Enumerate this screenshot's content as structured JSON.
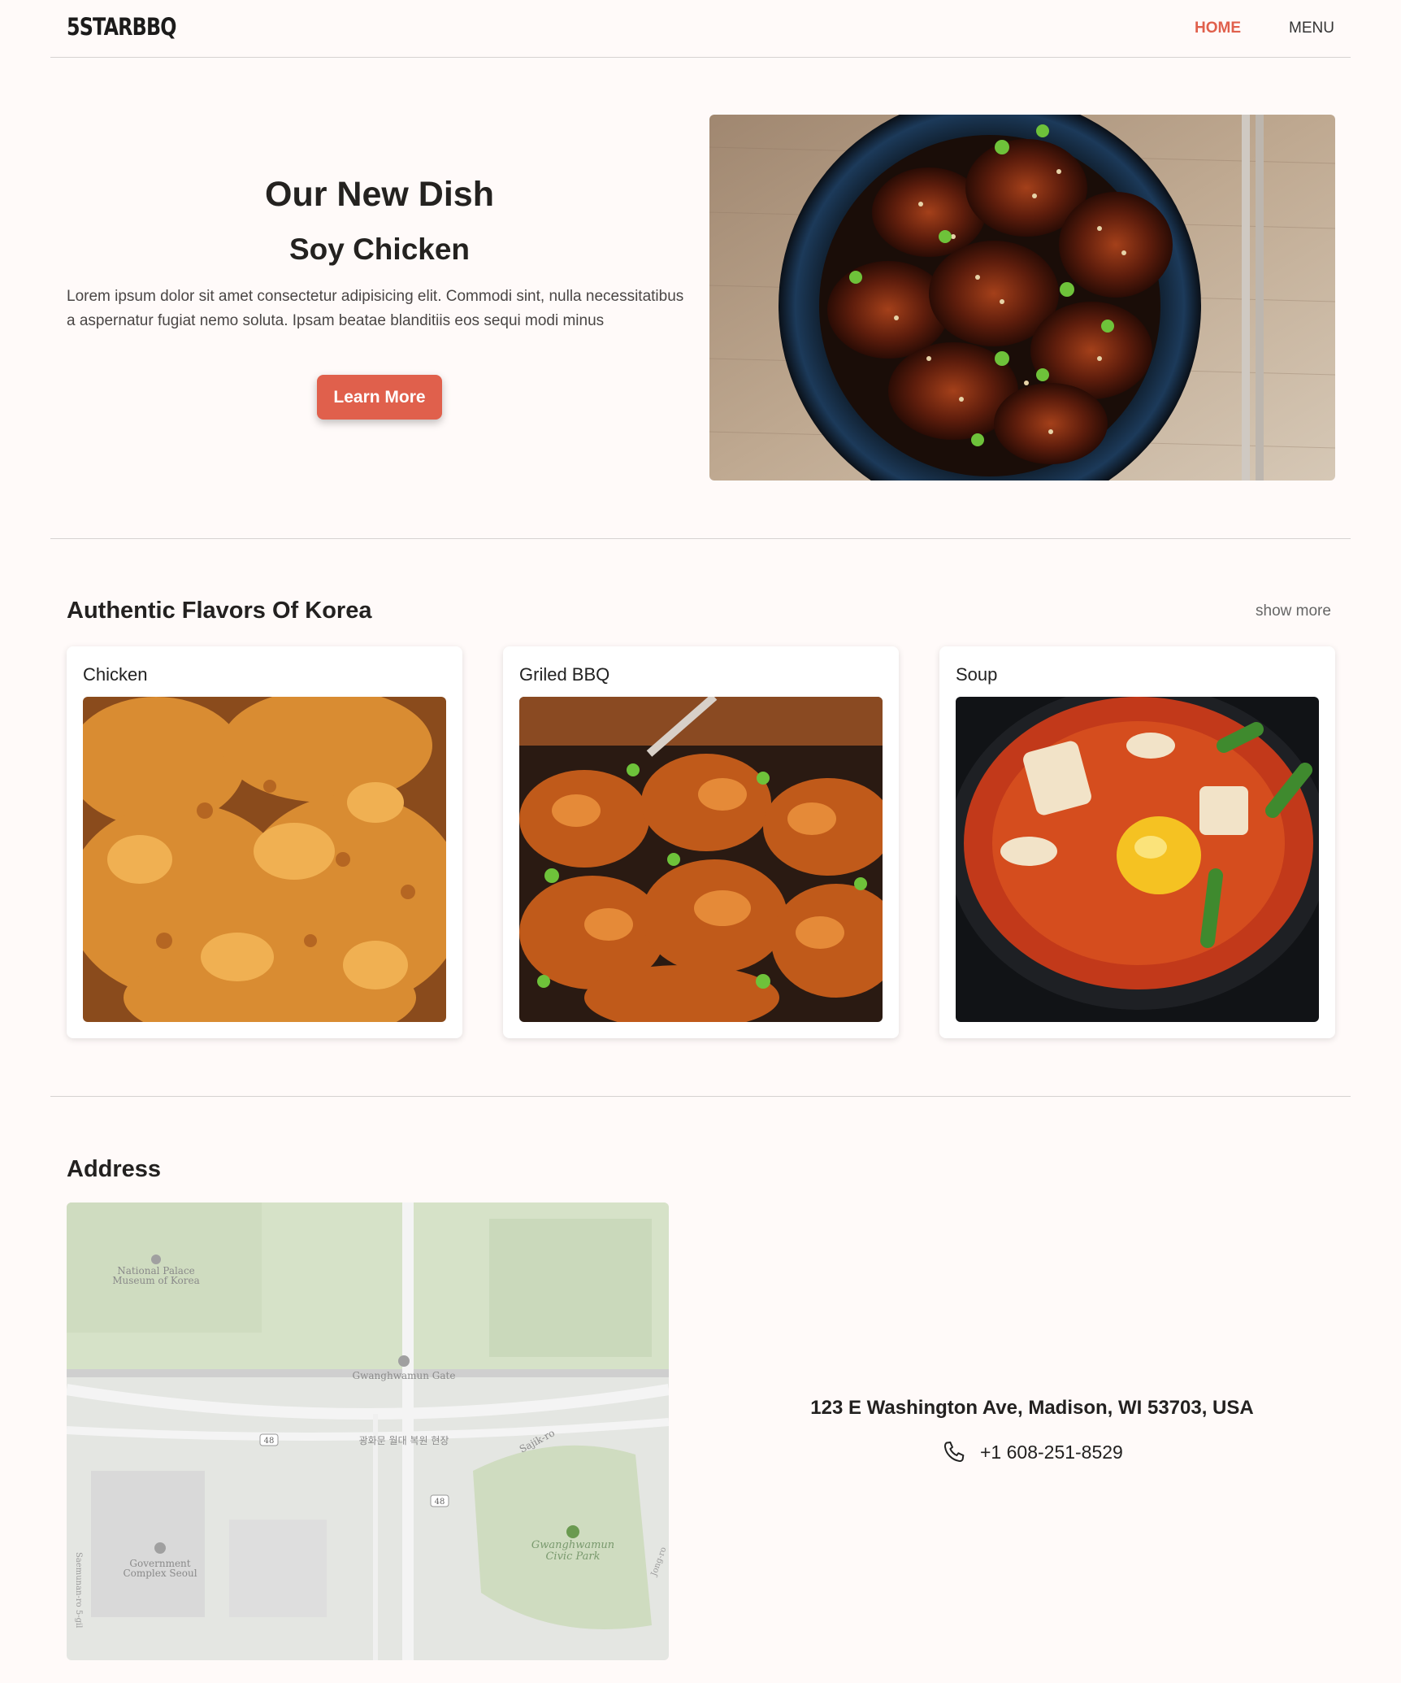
{
  "nav": {
    "logo": "5STARBBQ",
    "home": "HOME",
    "menu": "MENU"
  },
  "hero": {
    "title": "Our New Dish",
    "subtitle": "Soy Chicken",
    "text": "Lorem ipsum dolor sit amet consectetur adipisicing elit. Commodi sint, nulla necessitatibus a aspernatur fugiat nemo soluta. Ipsam beatae blanditiis eos sequi modi minus",
    "button": "Learn More",
    "image_icon": "soy-chicken-bowl-image"
  },
  "flavors": {
    "title": "Authentic Flavors Of Korea",
    "show_more": "show more",
    "cards": [
      {
        "title": "Chicken"
      },
      {
        "title": "Griled BBQ"
      },
      {
        "title": "Soup"
      }
    ]
  },
  "address": {
    "title": "Address",
    "line": "123 E Washington Ave, Madison, WI 53703, USA",
    "phone": "+1 608-251-8529",
    "phone_icon": "phone-icon",
    "map_labels": {
      "museum_1": "National Palace",
      "museum_2": "Museum of Korea",
      "gate": "Gwanghwamun Gate",
      "korean_site": "광화문 월대 복원 현장",
      "road": "Sajik-ro",
      "route_1": "48",
      "route_2": "48",
      "park_1": "Gwanghwamun",
      "park_2": "Civic Park",
      "gov_1": "Government",
      "gov_2": "Complex Seoul",
      "street_left": "Saemunan-ro 5-gil",
      "street_right": "Jong-ro"
    }
  },
  "colors": {
    "accent": "#e0604c",
    "background": "#fffaf9",
    "text": "#232120"
  }
}
